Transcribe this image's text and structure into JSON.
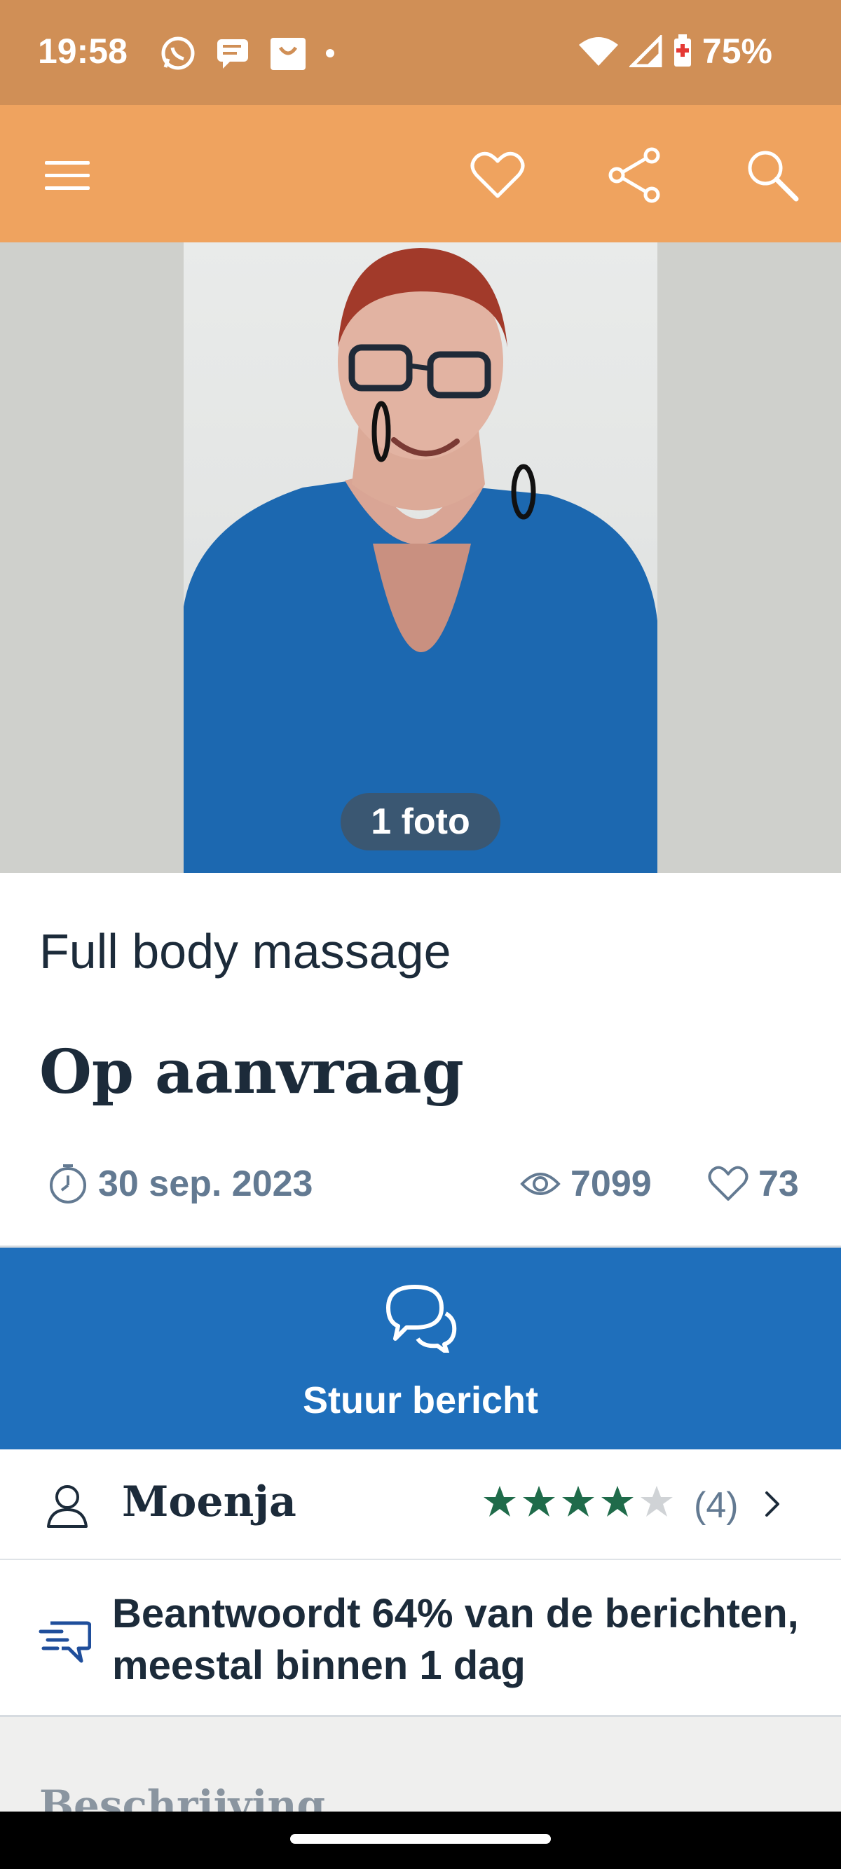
{
  "status_bar": {
    "time": "19:58",
    "battery": "75%",
    "icons": [
      "whatsapp-icon",
      "message-icon",
      "shopping-bag-icon",
      "dot-icon",
      "wifi-icon",
      "signal-icon",
      "battery-icon"
    ]
  },
  "app_bar": {
    "icons": [
      "menu-icon",
      "heart-icon",
      "share-icon",
      "search-icon"
    ]
  },
  "gallery": {
    "photo_count": "1 foto"
  },
  "listing": {
    "title": "Full body massage",
    "price": "Op aanvraag",
    "date": "30 sep. 2023",
    "views": "7099",
    "favorites": "73"
  },
  "cta": {
    "label": "Stuur bericht"
  },
  "seller": {
    "name": "Moenja",
    "rating": 4,
    "rating_max": 5,
    "review_count": "(4)"
  },
  "response": {
    "text": "Beantwoordt 64% van de berichten, meestal binnen 1 dag"
  },
  "description": {
    "heading": "Beschrijving"
  },
  "colors": {
    "status_bar": "#d08f56",
    "app_bar": "#efa35f",
    "cta": "#1f6fbb",
    "text_dark": "#1c2b3a",
    "text_muted": "#637a92",
    "star_filled": "#1f6b4a",
    "star_empty": "#d0d3d6"
  }
}
